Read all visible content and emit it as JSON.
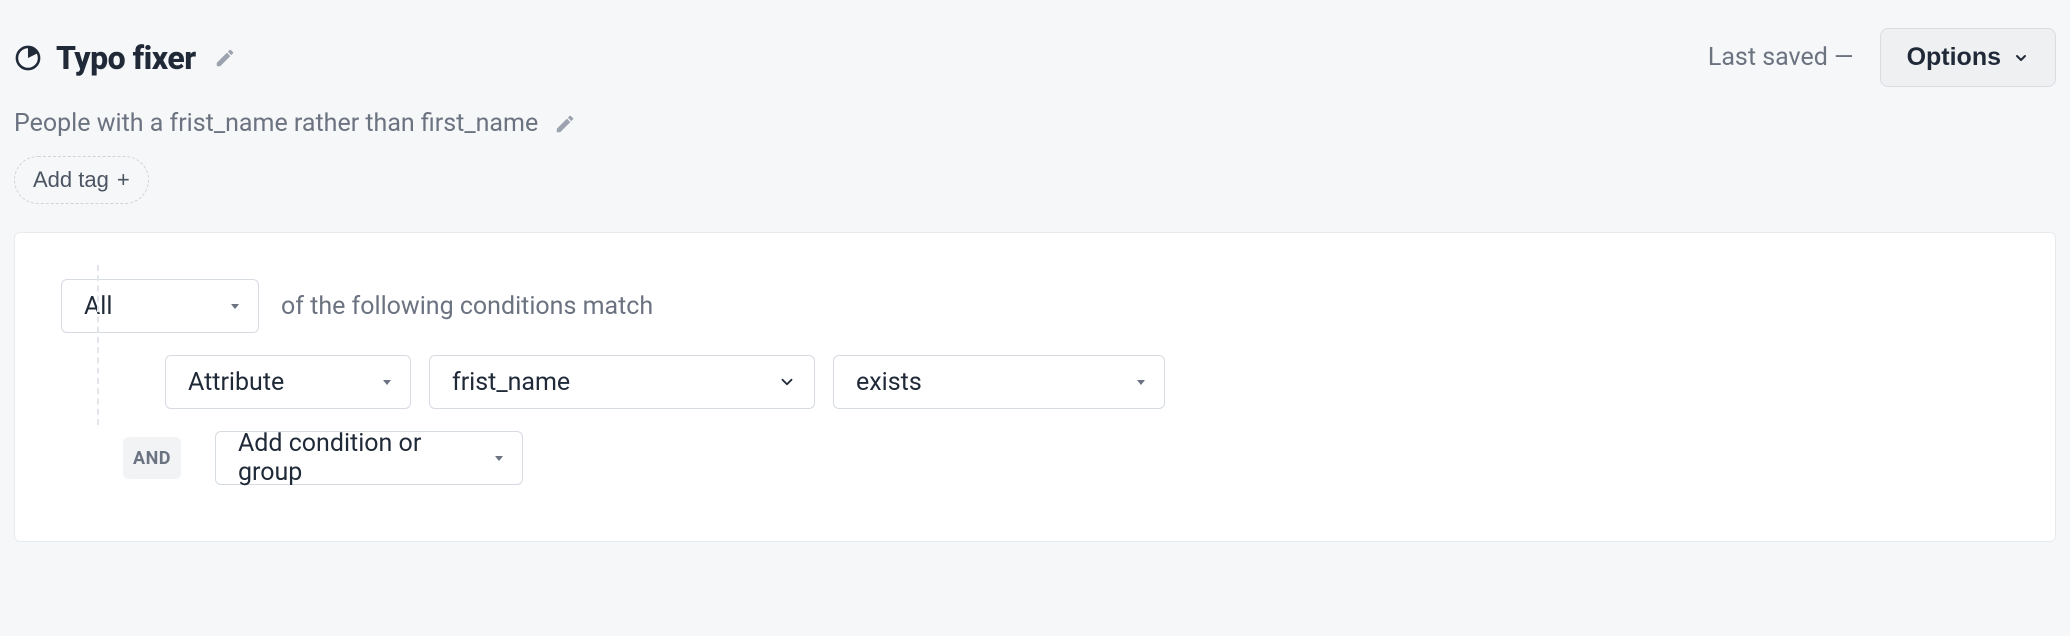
{
  "header": {
    "title": "Typo fixer",
    "last_saved_label": "Last saved —",
    "options_label": "Options"
  },
  "description": "People with a frist_name rather than first_name",
  "tags": {
    "add_tag_label": "Add tag"
  },
  "conditions": {
    "match_select_value": "All",
    "match_label_suffix": "of the following conditions match",
    "rows": [
      {
        "type_value": "Attribute",
        "attribute_value": "frist_name",
        "operator_value": "exists"
      }
    ],
    "connector_label": "AND",
    "add_condition_label": "Add condition or group"
  }
}
